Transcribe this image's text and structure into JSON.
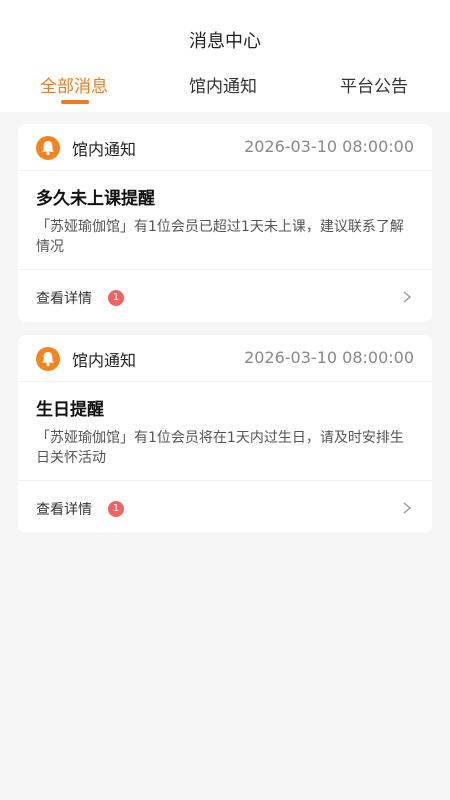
{
  "header": {
    "title": "消息中心",
    "tabs": [
      {
        "label": "全部消息",
        "active": true
      },
      {
        "label": "馆内通知",
        "active": false
      },
      {
        "label": "平台公告",
        "active": false
      }
    ]
  },
  "colors": {
    "accent": "#f07b1d",
    "bell_bg": "#f5841f",
    "badge": "#ef6363"
  },
  "messages": [
    {
      "type": "馆内通知",
      "time": "2026-03-10 08:00:00",
      "title": "多久未上课提醒",
      "body": "「苏娅瑜伽馆」有1位会员已超过1天未上课，建议联系了解情况",
      "detail_label": "查看详情",
      "badge": "1",
      "icon": "bell-icon"
    },
    {
      "type": "馆内通知",
      "time": "2026-03-10 08:00:00",
      "title": "生日提醒",
      "body": "「苏娅瑜伽馆」有1位会员将在1天内过生日，请及时安排生日关怀活动",
      "detail_label": "查看详情",
      "badge": "1",
      "icon": "bell-icon"
    }
  ]
}
